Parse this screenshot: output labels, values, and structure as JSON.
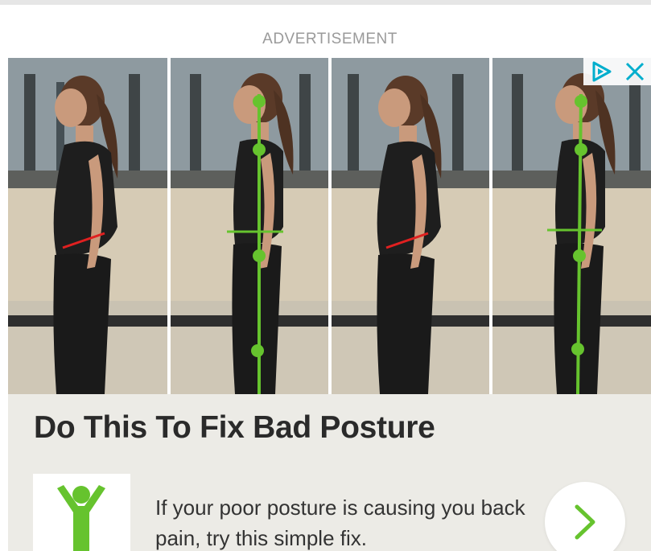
{
  "ad": {
    "label": "ADVERTISEMENT",
    "headline": "Do This To Fix Bad Posture",
    "description": "If your poor posture is causing you back pain, try this simple fix.",
    "icons": {
      "adchoices": "adchoices-icon",
      "close": "close-icon",
      "logo": "person-arms-raised-icon",
      "cta": "chevron-right-icon"
    },
    "colors": {
      "accent": "#66c32e",
      "bad_posture_line": "#e02020",
      "adchoices_blue": "#00aecd",
      "card_bg": "#ecebe6"
    }
  }
}
